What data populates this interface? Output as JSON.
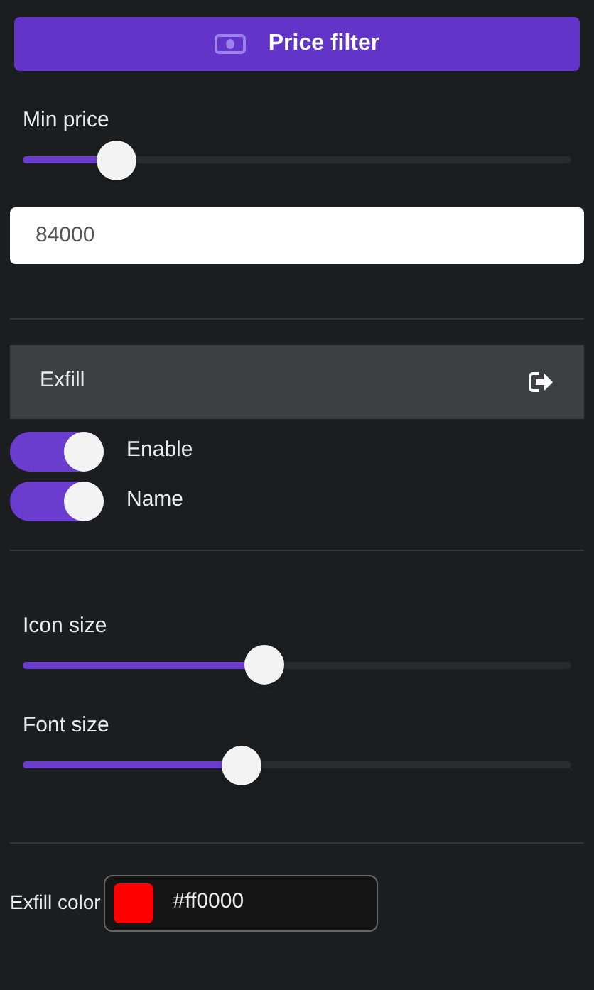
{
  "header_button": {
    "label": "Price filter"
  },
  "min_price": {
    "label": "Min price",
    "level": 0.17,
    "value": "84000"
  },
  "exfill": {
    "title": "Exfill",
    "toggles": [
      {
        "label": "Enable",
        "on": true
      },
      {
        "label": "Name",
        "on": true
      }
    ],
    "sliders": [
      {
        "label": "Icon size",
        "level": 0.44
      },
      {
        "label": "Font size",
        "level": 0.4
      }
    ],
    "color": {
      "label": "Exfill color",
      "value": "#ff0000"
    }
  }
}
